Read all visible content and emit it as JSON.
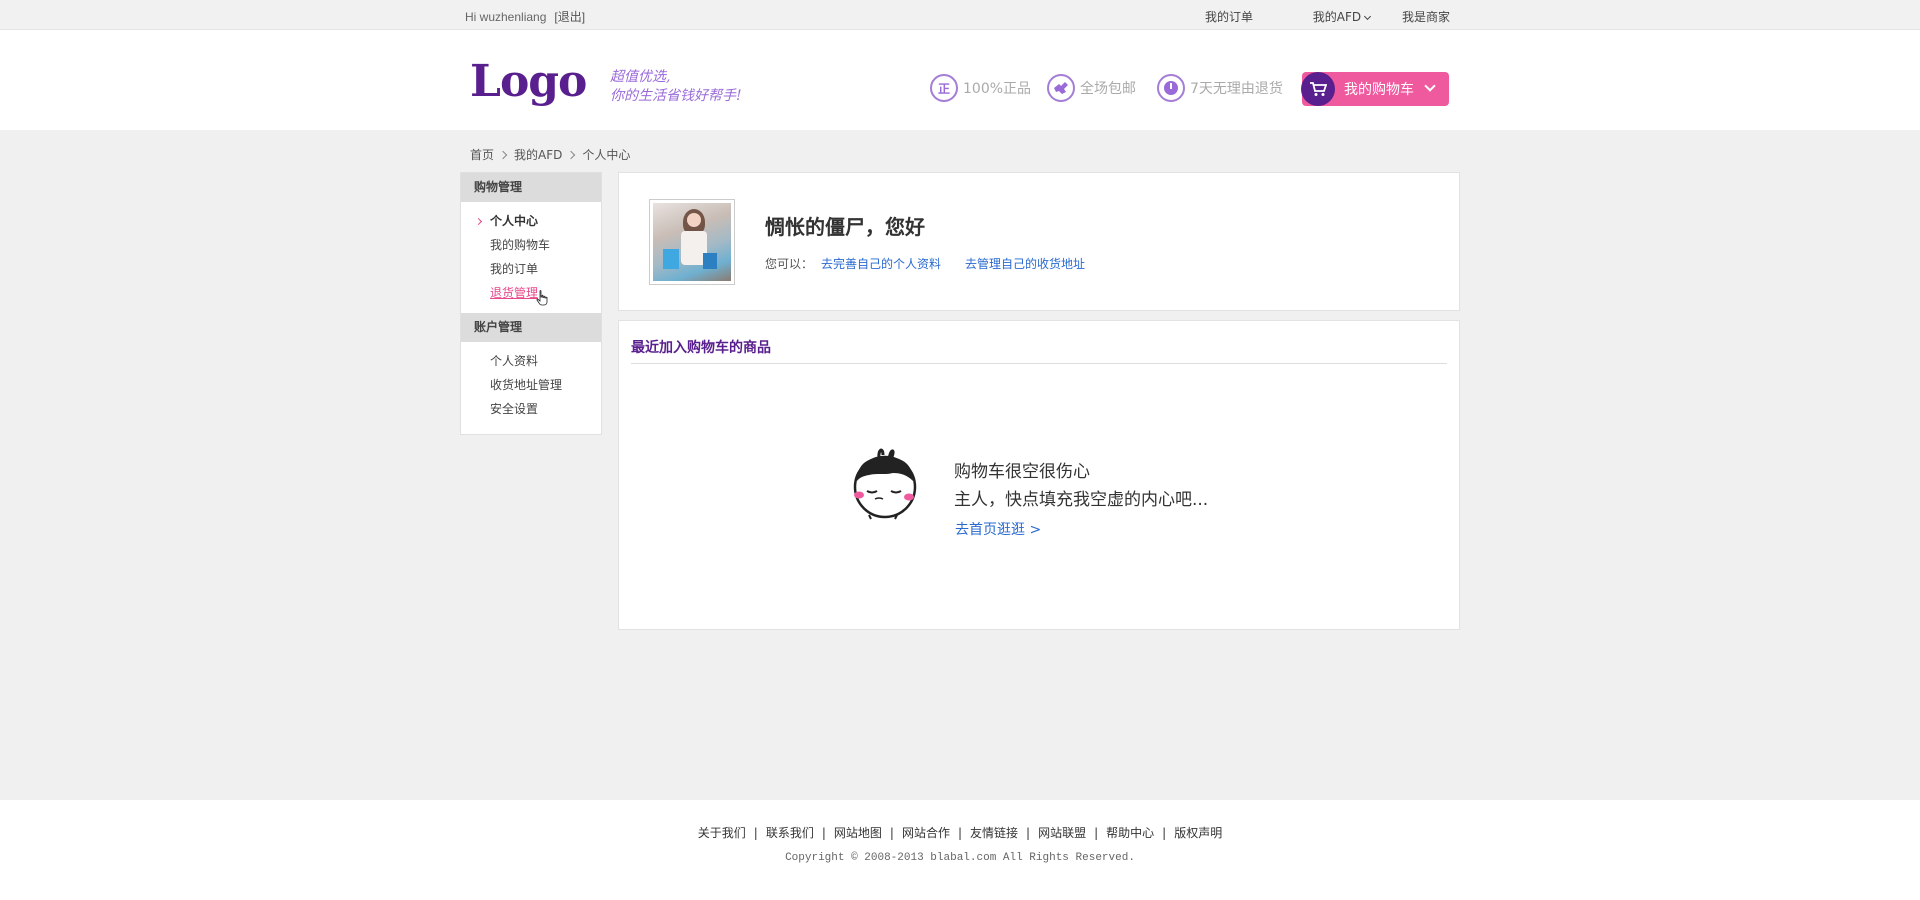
{
  "topbar": {
    "greeting": "Hi wuzhenliang",
    "logout": "[退出]",
    "links": [
      "我的订单",
      "我的AFD",
      "我是商家"
    ]
  },
  "header": {
    "logo": "Logo",
    "slogan_line1": "超值优选,",
    "slogan_line2": "你的生活省钱好帮手!",
    "features": [
      {
        "icon": "genuine-icon",
        "icon_text": "正",
        "label": "100%正品"
      },
      {
        "icon": "free-shipping-icon",
        "label": "全场包邮"
      },
      {
        "icon": "clock-icon",
        "label": "7天无理由退货"
      }
    ],
    "cart_button": "我的购物车"
  },
  "breadcrumb": [
    "首页",
    "我的AFD",
    "个人中心"
  ],
  "sidebar": {
    "groups": [
      {
        "title": "购物管理",
        "items": [
          "个人中心",
          "我的购物车",
          "我的订单",
          "退货管理"
        ]
      },
      {
        "title": "账户管理",
        "items": [
          "个人资料",
          "收货地址管理",
          "安全设置"
        ]
      }
    ]
  },
  "profile": {
    "greeting": "惆怅的僵尸，您好",
    "can_do_label": "您可以：",
    "link_profile": "去完善自己的个人资料",
    "link_address": "去管理自己的收货地址"
  },
  "recent_cart": {
    "title": "最近加入购物车的商品",
    "empty_line1": "购物车很空很伤心",
    "empty_line2": "主人，快点填充我空虚的内心吧...",
    "go_home": "去首页逛逛 >"
  },
  "footer": {
    "links": [
      "关于我们",
      "联系我们",
      "网站地图",
      "网站合作",
      "友情链接",
      "网站联盟",
      "帮助中心",
      "版权声明"
    ],
    "copyright": "Copyright © 2008-2013 blabal.com All Rights Reserved."
  },
  "colors": {
    "brand_purple": "#5a1f8e",
    "accent_pink": "#ef5a9e",
    "link_blue": "#2a6ad0"
  }
}
